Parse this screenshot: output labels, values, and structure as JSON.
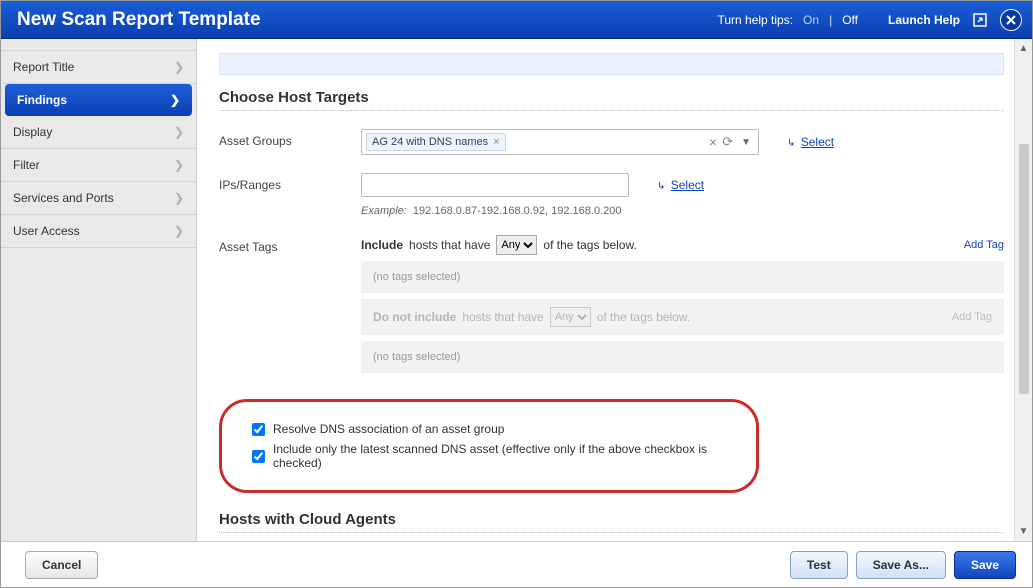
{
  "titlebar": {
    "title": "New Scan Report Template",
    "help_tips_label": "Turn help tips:",
    "on": "On",
    "off": "Off",
    "launch_help": "Launch Help"
  },
  "sidebar": {
    "items": [
      {
        "label": "Report Title",
        "active": false
      },
      {
        "label": "Findings",
        "active": true
      },
      {
        "label": "Display",
        "active": false
      },
      {
        "label": "Filter",
        "active": false
      },
      {
        "label": "Services and Ports",
        "active": false
      },
      {
        "label": "User Access",
        "active": false
      }
    ]
  },
  "main": {
    "section_title": "Choose Host Targets",
    "asset_groups": {
      "label": "Asset Groups",
      "chips": [
        "AG 24 with DNS names"
      ],
      "select_link": "Select"
    },
    "ips_ranges": {
      "label": "IPs/Ranges",
      "value": "",
      "select_link": "Select",
      "example_prefix": "Example:",
      "example_text": "192.168.0.87-192.168.0.92, 192.168.0.200"
    },
    "asset_tags": {
      "label": "Asset Tags",
      "include_prefix": "Include",
      "include_mid": "hosts that have",
      "include_suffix": "of the tags below.",
      "include_dropdown": "Any",
      "add_tag": "Add Tag",
      "no_tags": "(no tags selected)",
      "exclude_prefix": "Do not include",
      "exclude_mid": "hosts that have",
      "exclude_suffix": "of the tags below.",
      "exclude_dropdown": "Any"
    },
    "checkboxes": {
      "resolve_dns": {
        "checked": true,
        "label": "Resolve DNS association of an asset group"
      },
      "latest_dns": {
        "checked": true,
        "label": "Include only the latest scanned DNS asset (effective only if the above checkbox is checked)"
      }
    },
    "cloud_agents_title": "Hosts with Cloud Agents"
  },
  "footer": {
    "cancel": "Cancel",
    "test": "Test",
    "save_as": "Save As...",
    "save": "Save"
  }
}
